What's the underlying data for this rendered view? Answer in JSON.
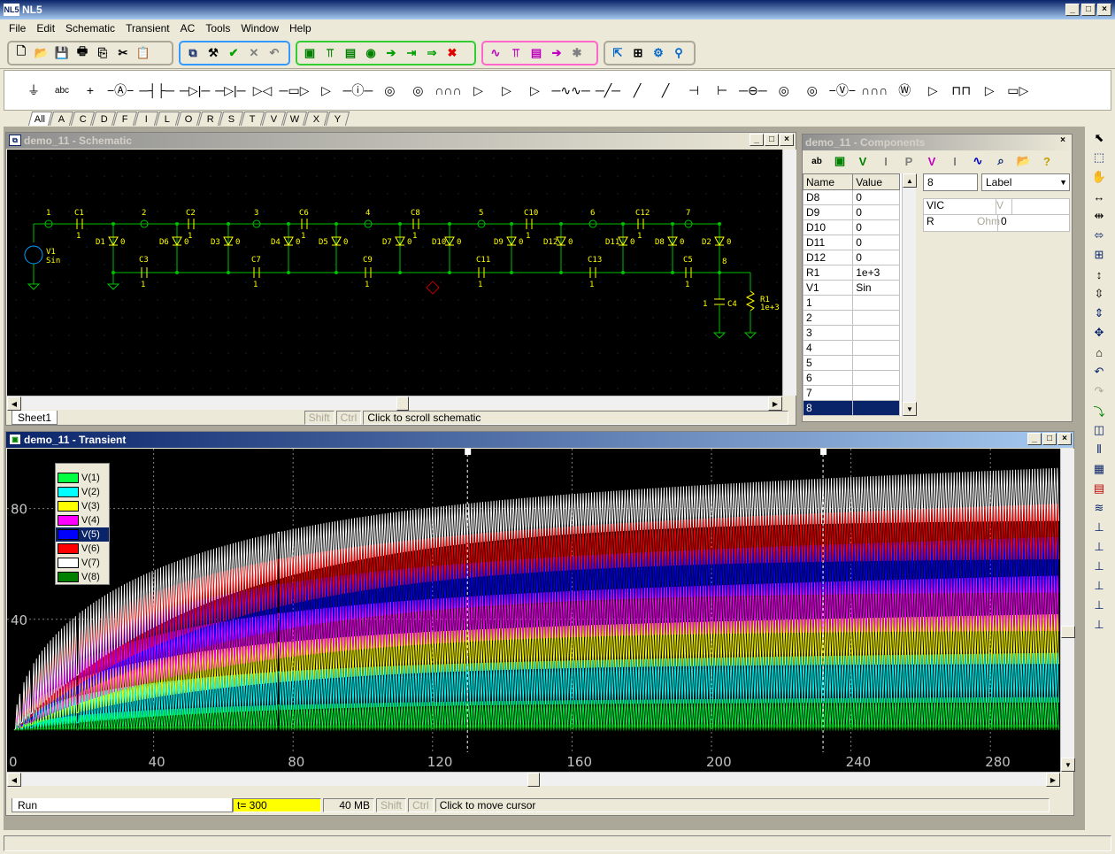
{
  "app": {
    "title": "NL5",
    "logo": "NL5"
  },
  "menu": [
    "File",
    "Edit",
    "Schematic",
    "Transient",
    "AC",
    "Tools",
    "Window",
    "Help"
  ],
  "toolbar1": {
    "group1": [
      "new-icon",
      "open-icon",
      "save-icon",
      "print-icon",
      "copy-icon",
      "cut-icon",
      "paste-icon"
    ],
    "group2": [
      "schematic-icon",
      "tools-icon",
      "check-icon",
      "delete-icon",
      "undo-icon"
    ],
    "group3": [
      "transient-icon",
      "probe-icon",
      "table-icon",
      "run-icon",
      "step-icon",
      "forward-icon",
      "continue-icon",
      "stop-icon"
    ],
    "group4": [
      "ac-icon",
      "ac-probe-icon",
      "ac-table-icon",
      "ac-run-icon",
      "ac-stop-icon"
    ],
    "group5": [
      "export-icon",
      "resize-icon",
      "settings-icon",
      "pin-icon"
    ]
  },
  "library_tabs": [
    "All",
    "A",
    "C",
    "D",
    "F",
    "I",
    "L",
    "O",
    "R",
    "S",
    "T",
    "V",
    "W",
    "X",
    "Y"
  ],
  "schematic": {
    "title": "demo_11 - Schematic",
    "sheet_tab": "Sheet1",
    "status": {
      "shift": "Shift",
      "ctrl": "Ctrl",
      "hint": "Click to scroll schematic"
    },
    "nodes": [
      "1",
      "2",
      "3",
      "4",
      "5",
      "6",
      "7",
      "8"
    ],
    "caps_top": [
      "C1",
      "C2",
      "C6",
      "C8",
      "C10",
      "C12"
    ],
    "caps_bottom": [
      "C3",
      "C7",
      "C9",
      "C11",
      "C13",
      "C5"
    ],
    "source": {
      "name": "V1",
      "value": "Sin"
    },
    "resistor": {
      "name": "R1",
      "value": "1e+3"
    },
    "c4": "C4"
  },
  "components": {
    "title": "demo_11 - Components",
    "headers": [
      "Name",
      "Value"
    ],
    "rows": [
      {
        "name": "D8",
        "value": "0"
      },
      {
        "name": "D9",
        "value": "0"
      },
      {
        "name": "D10",
        "value": "0"
      },
      {
        "name": "D11",
        "value": "0"
      },
      {
        "name": "D12",
        "value": "0"
      },
      {
        "name": "R1",
        "value": "1e+3"
      },
      {
        "name": "V1",
        "value": "Sin"
      },
      {
        "name": "1",
        "value": ""
      },
      {
        "name": "2",
        "value": ""
      },
      {
        "name": "3",
        "value": ""
      },
      {
        "name": "4",
        "value": ""
      },
      {
        "name": "5",
        "value": ""
      },
      {
        "name": "6",
        "value": ""
      },
      {
        "name": "7",
        "value": ""
      },
      {
        "name": "8",
        "value": ""
      }
    ],
    "selected_row": 14,
    "field_value": "8",
    "dropdown": "Label",
    "props": [
      {
        "name": "VIC",
        "unit": "V",
        "value": ""
      },
      {
        "name": "R",
        "unit": "Ohm",
        "value": "0"
      }
    ]
  },
  "transient": {
    "title": "demo_11 - Transient",
    "run_tab": "Run",
    "status": {
      "time": "t= 300",
      "memory": "40 MB",
      "shift": "Shift",
      "ctrl": "Ctrl",
      "hint": "Click to move cursor"
    },
    "legend": [
      {
        "label": "V(1)",
        "color": "#00ff40"
      },
      {
        "label": "V(2)",
        "color": "#00ffff"
      },
      {
        "label": "V(3)",
        "color": "#ffff00"
      },
      {
        "label": "V(4)",
        "color": "#ff00ff"
      },
      {
        "label": "V(5)",
        "color": "#0000ff"
      },
      {
        "label": "V(6)",
        "color": "#ff0000"
      },
      {
        "label": "V(7)",
        "color": "#ffffff"
      },
      {
        "label": "V(8)",
        "color": "#008000"
      }
    ],
    "selected_legend": 4
  },
  "chart_data": {
    "type": "line",
    "x_ticks": [
      0,
      40,
      80,
      120,
      160,
      200,
      240,
      280
    ],
    "y_ticks": [
      40,
      80
    ],
    "xlim": [
      0,
      300
    ],
    "ylim": [
      -8,
      100
    ],
    "grid": true,
    "legend_placement": "top-left",
    "series": [
      {
        "name": "V(1)",
        "color": "#00ff40",
        "low": 0,
        "high": 12
      },
      {
        "name": "V(2)",
        "color": "#00ffff",
        "low": 10,
        "high": 28
      },
      {
        "name": "V(3)",
        "color": "#ffff00",
        "low": 24,
        "high": 42
      },
      {
        "name": "V(4)",
        "color": "#ff00ff",
        "low": 36,
        "high": 56
      },
      {
        "name": "V(5)",
        "color": "#0000ff",
        "low": 50,
        "high": 70
      },
      {
        "name": "V(6)",
        "color": "#ff0000",
        "low": 62,
        "high": 82
      },
      {
        "name": "V(7)",
        "color": "#ffffff",
        "low": 76,
        "high": 95
      },
      {
        "name": "V(8)",
        "color": "#008000",
        "low": 0,
        "high": 2
      }
    ]
  }
}
